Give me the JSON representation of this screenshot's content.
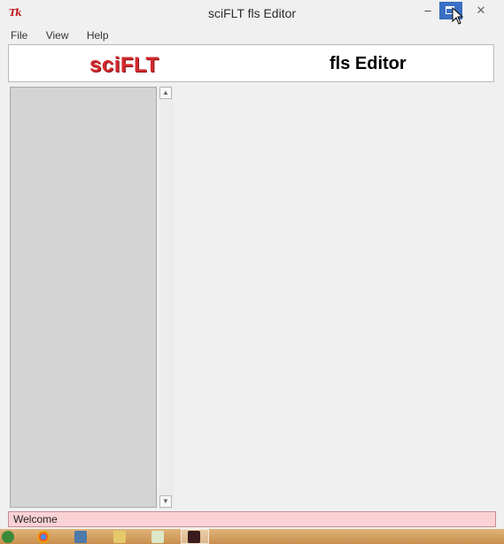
{
  "window": {
    "title": "sciFLT fls Editor",
    "icon_label": "Tk",
    "minimize_glyph": "–",
    "close_glyph": "✕"
  },
  "menu": {
    "items": [
      {
        "label": "File"
      },
      {
        "label": "View"
      },
      {
        "label": "Help"
      }
    ]
  },
  "header": {
    "logo_text": "sciFLT",
    "title": "fls Editor"
  },
  "scrollbar": {
    "up_glyph": "▲",
    "down_glyph": "▼"
  },
  "status": {
    "text": "Welcome"
  },
  "colors": {
    "logo_red": "#d22a2e",
    "status_bg": "#fad2d6",
    "maximize_hover": "#3a6fc4"
  }
}
